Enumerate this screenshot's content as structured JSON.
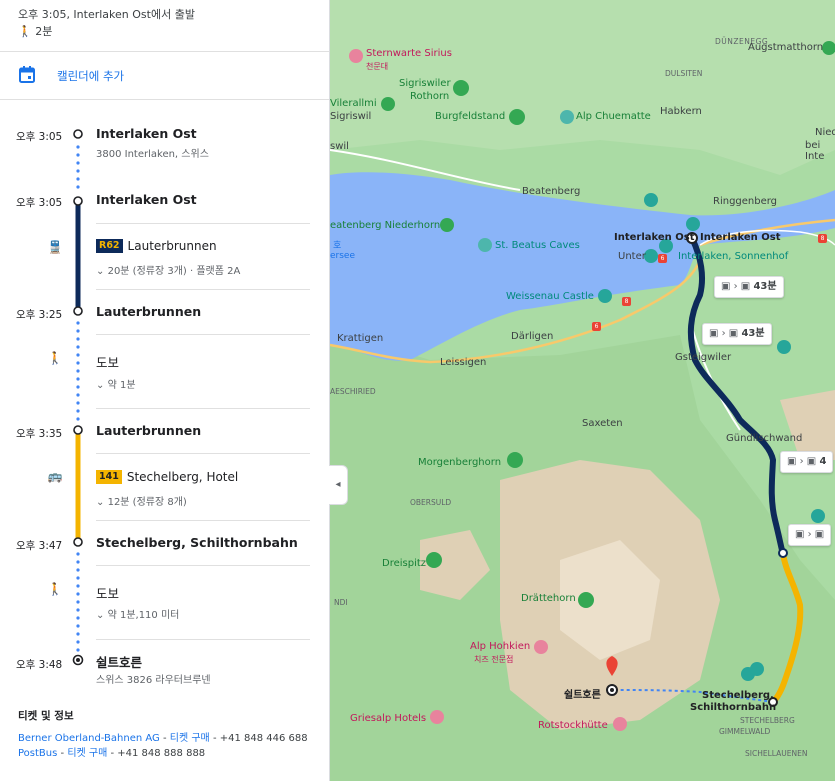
{
  "header": {
    "departure": "오후 3:05, Interlaken Ost에서 출발",
    "walk_total": "2분"
  },
  "calendar": {
    "label": "캘린더에 추가"
  },
  "steps": {
    "s0": {
      "time": "오후 3:05",
      "name": "Interlaken Ost",
      "address": "3800 Interlaken, 스위스"
    },
    "s1": {
      "time": "오후 3:05",
      "name": "Interlaken Ost"
    },
    "r1": {
      "badge": "R62",
      "name": "Lauterbrunnen",
      "detail": "20분 (정류장 3개) · 플랫폼 2A"
    },
    "s2": {
      "time": "오후 3:25",
      "name": "Lauterbrunnen"
    },
    "w1": {
      "label": "도보",
      "detail": "약 1분"
    },
    "s3": {
      "time": "오후 3:35",
      "name": "Lauterbrunnen"
    },
    "r2": {
      "badge": "141",
      "name": "Stechelberg, Hotel",
      "detail": "12분 (정류장 8개)"
    },
    "s4": {
      "time": "오후 3:47",
      "name": "Stechelberg, Schilthornbahn"
    },
    "w2": {
      "label": "도보",
      "detail": "약 1분,110 미터"
    },
    "s5": {
      "time": "오후 3:48",
      "name": "쉴트호른",
      "address": "스위스 3826 라우터브루넨"
    }
  },
  "info": {
    "title": "티켓 및 정보",
    "line1_operator": "Berner Oberland-Bahnen AG",
    "line1_sep": " - ",
    "line1_ticket": "티켓 구매",
    "line1_phone": " - +41 848 446 688",
    "line2_operator": "PostBus",
    "line2_sep": " - ",
    "line2_ticket": "티켓 구매",
    "line2_phone": " - +41 848 888 888"
  },
  "map": {
    "labels": {
      "duenzenegg": "DÜNZENEGG",
      "sternwarte": "Sternwarte Sirius",
      "sternwarte_ko": "천문대",
      "augstmatthorn": "Augstmatthorn",
      "dulsiten": "DULSITEN",
      "sigriswiler": "Sigriswiler",
      "rothorn": "Rothorn",
      "vilerallmi": "Vilerallmi",
      "sigriswil": "Sigriswil",
      "burgfeldstand": "Burgfeldstand",
      "alp_chuematte": "Alp Chuematte",
      "habkern": "Habkern",
      "swil": "swil",
      "nied": "Nied",
      "bei_inte": "bei Inte",
      "beatenberg": "Beatenberg",
      "ringgenberg": "Ringgenberg",
      "beatenberg_niederhorn": "eatenberg Niederhorn",
      "stbeatus": "St. Beatus Caves",
      "unsee_ko": "호",
      "unsee": "ersee",
      "interlaken_ost_a": "Interlaken Ost",
      "interlaken_ost_b": "Interlaken Ost",
      "unter": "Unter",
      "sonnenhof": "Interlaken, Sonnenhof",
      "weissenau": "Weissenau Castle",
      "krattigen": "Krattigen",
      "daerligen": "Därligen",
      "leissigen": "Leissigen",
      "gsteigwiler": "Gsteigwiler",
      "aeschiried": "AESCHIRIED",
      "saxeten": "Saxeten",
      "guendlischwand": "Gündlischwand",
      "morgenberghorn": "Morgenberghorn",
      "obersuld": "OBERSULD",
      "dreispitz": "Dreispitz",
      "ndi": "NDI",
      "draettehorn": "Drättehorn",
      "alp_hohkien": "Alp Hohkien",
      "alp_hohkien_ko": "치즈 전문점",
      "schilthorn": "쉴트호른",
      "stechelberg_a": "Stechelberg,",
      "stechelberg_b": "Schilthornbahn",
      "stechelberg_c": "STECHELBERG",
      "griesalp": "Griesalp Hotels",
      "rotstock": "Rotstockhütte",
      "gimmelwald": "GIMMELWALD",
      "sichellauenen": "SICHELLAUENEN",
      "road8a": "8",
      "road8b": "8",
      "road6a": "6",
      "road6b": "6"
    },
    "chips": {
      "c1": "43분",
      "c2": "43분",
      "c3": "4",
      "c4": ""
    }
  }
}
